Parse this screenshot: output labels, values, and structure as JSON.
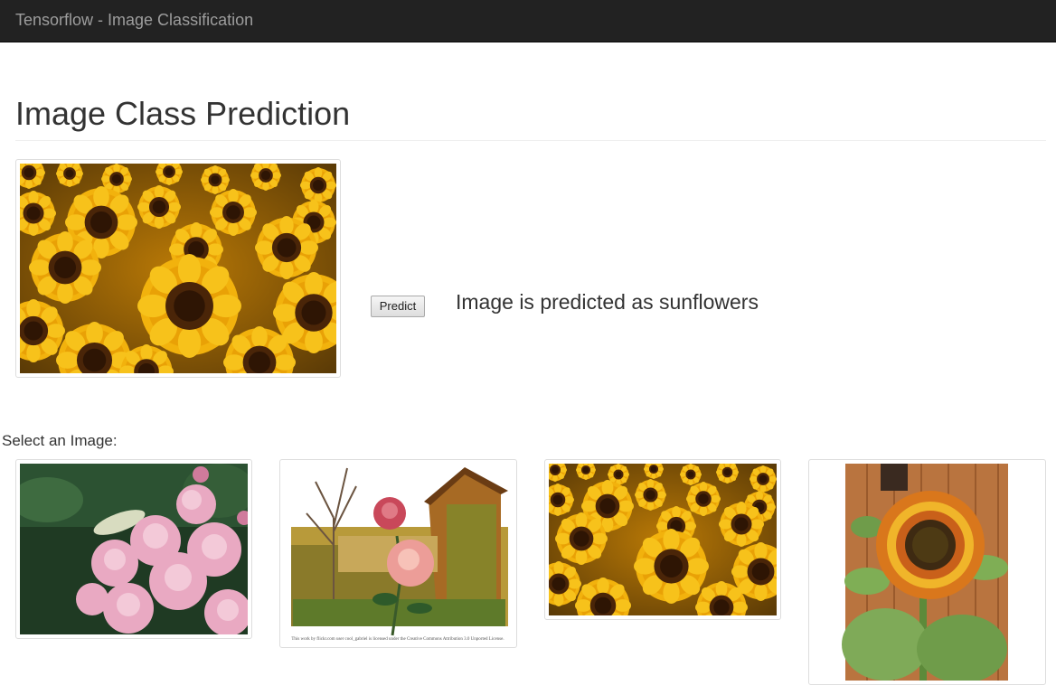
{
  "navbar": {
    "brand": "Tensorflow - Image Classification"
  },
  "main": {
    "title": "Image Class Prediction",
    "selected_image_alt": "sunflowers field",
    "predict_label": "Predict",
    "prediction_text": "Image is predicted as sunflowers"
  },
  "gallery": {
    "label": "Select an Image:",
    "images": [
      {
        "alt": "pink roses",
        "icon": "rose-bush-image"
      },
      {
        "alt": "rose in front of barn",
        "icon": "rose-barn-image",
        "caption": "This work by flickr.com user cool_gabriel is licensed under the Creative Commons Attribution 3.0 Unported License."
      },
      {
        "alt": "sunflowers field",
        "icon": "sunflowers-image"
      },
      {
        "alt": "single sunflower",
        "icon": "sunflower-image"
      }
    ]
  },
  "colors": {
    "navbar_bg": "#222222",
    "brand_text": "#9d9d9d",
    "text": "#333333",
    "rule": "#eeeeee",
    "thumb_border": "#dddddd"
  }
}
